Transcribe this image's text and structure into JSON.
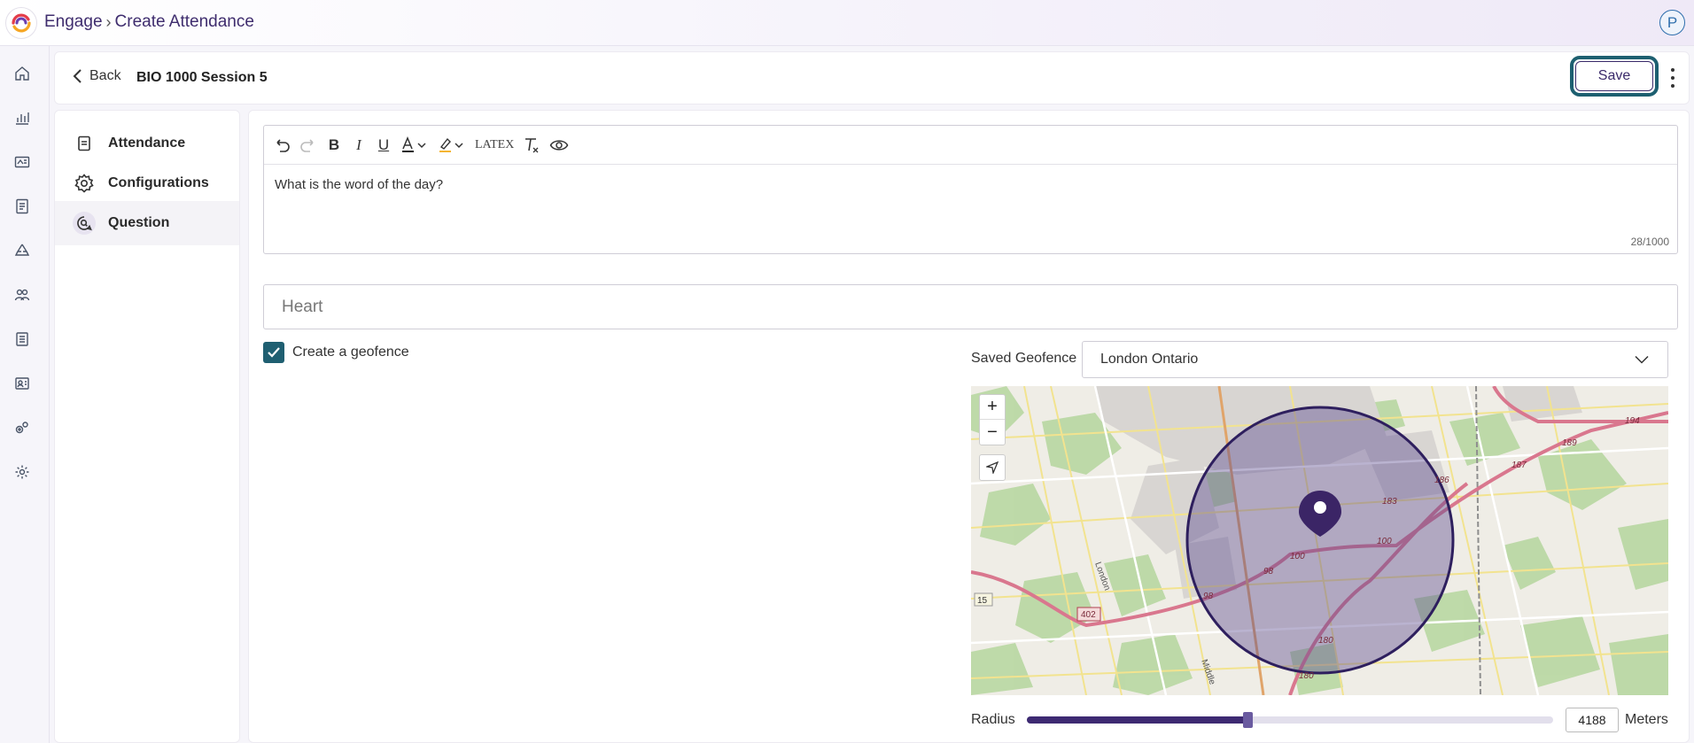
{
  "topbar": {
    "breadcrumb_root": "Engage",
    "breadcrumb_current": "Create Attendance",
    "avatar_initial": "P"
  },
  "header": {
    "back_label": "Back",
    "session_title": "BIO 1000 Session 5",
    "save_label": "Save"
  },
  "nav": {
    "items": [
      {
        "label": "Attendance",
        "icon": "document-icon"
      },
      {
        "label": "Configurations",
        "icon": "gear-icon"
      },
      {
        "label": "Question",
        "icon": "chat-search-icon",
        "active": true
      }
    ]
  },
  "editor": {
    "toolbar": {
      "latex_label": "LATEX"
    },
    "text": "What is the word of the day?",
    "counter": "28/1000"
  },
  "answer": {
    "value": "Heart"
  },
  "geofence": {
    "checkbox_label": "Create a geofence",
    "checked": true,
    "saved_label": "Saved Geofence",
    "selected": "London Ontario",
    "radius_label": "Radius",
    "radius_value": "4188",
    "radius_unit": "Meters",
    "radius_fraction": 0.42
  },
  "map": {
    "road_labels": [
      "402",
      "15",
      "194",
      "189",
      "187",
      "186",
      "183",
      "100",
      "100",
      "98",
      "98",
      "180",
      "180",
      "London",
      "Middle"
    ],
    "colors": {
      "fence_fill": "#5b4a8f",
      "fence_stroke": "#2e1f5e",
      "pin": "#3b2566",
      "highway": "#d9778e"
    }
  },
  "colors": {
    "accent": "#3d2a72",
    "focus_ring": "#1d5f70",
    "checkbox": "#1f5f71"
  }
}
